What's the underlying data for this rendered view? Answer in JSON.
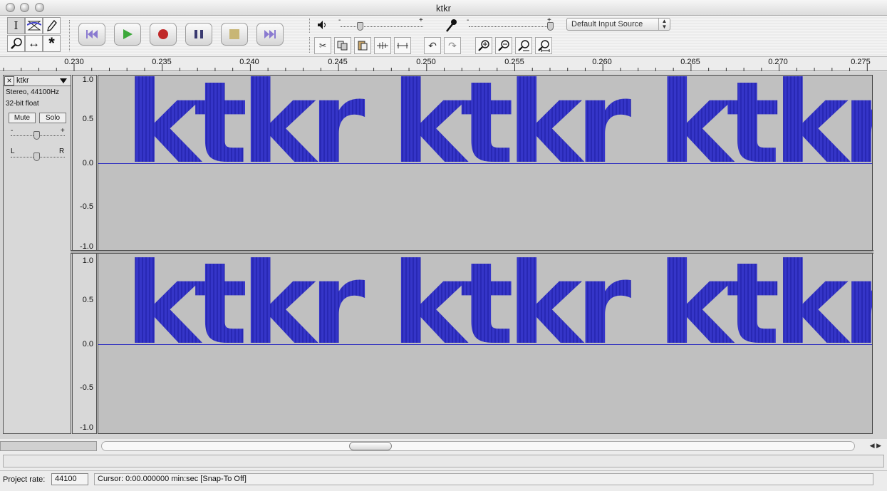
{
  "window": {
    "title": "ktkr"
  },
  "toolbar": {
    "tools": [
      "selection-tool",
      "envelope-tool",
      "draw-tool",
      "zoom-tool",
      "time-shift-tool",
      "multi-tool"
    ],
    "transport": [
      "skip-to-start",
      "play",
      "record",
      "pause",
      "stop",
      "skip-to-end"
    ],
    "volume": {
      "minus": "-",
      "plus": "+"
    },
    "mic": {
      "minus": "-",
      "plus": "+"
    },
    "input_source": "Default Input Source"
  },
  "ruler": {
    "labels": [
      "0.230",
      "0.235",
      "0.240",
      "0.245",
      "0.250",
      "0.255",
      "0.260",
      "0.265",
      "0.270",
      "0.275"
    ]
  },
  "track": {
    "name": "ktkr",
    "format": "Stereo, 44100Hz",
    "bitdepth": "32-bit float",
    "mute": "Mute",
    "solo": "Solo",
    "gain_minus": "-",
    "gain_plus": "+",
    "pan_left": "L",
    "pan_right": "R",
    "waveform_text": "ktkr ktkr ktkr ktk"
  },
  "vruler": {
    "labels": [
      "1.0",
      "0.5",
      "0.0",
      "-0.5",
      "-1.0"
    ]
  },
  "status": {
    "project_rate_label": "Project rate:",
    "project_rate": "44100",
    "cursor": "Cursor: 0:00.000000 min:sec   [Snap-To Off]"
  }
}
